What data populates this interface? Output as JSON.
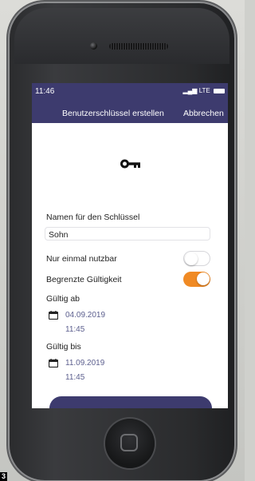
{
  "status": {
    "time": "11:46",
    "network": "LTE"
  },
  "navbar": {
    "title": "Benutzerschlüssel erstellen",
    "cancel": "Abbrechen"
  },
  "form": {
    "name_label": "Namen für den Schlüssel",
    "name_value": "Sohn",
    "single_use_label": "Nur einmal nutzbar",
    "single_use_on": false,
    "limited_label": "Begrenzte Gültigkeit",
    "limited_on": true,
    "valid_from_label": "Gültig ab",
    "valid_from_date": "04.09.2019",
    "valid_from_time": "11:45",
    "valid_to_label": "Gültig bis",
    "valid_to_date": "11.09.2019",
    "valid_to_time": "11:45"
  },
  "colors": {
    "accent": "#3d3b6e",
    "toggle_on": "#f08a24",
    "date_text": "#5c5f8e"
  },
  "corner_label": "3"
}
